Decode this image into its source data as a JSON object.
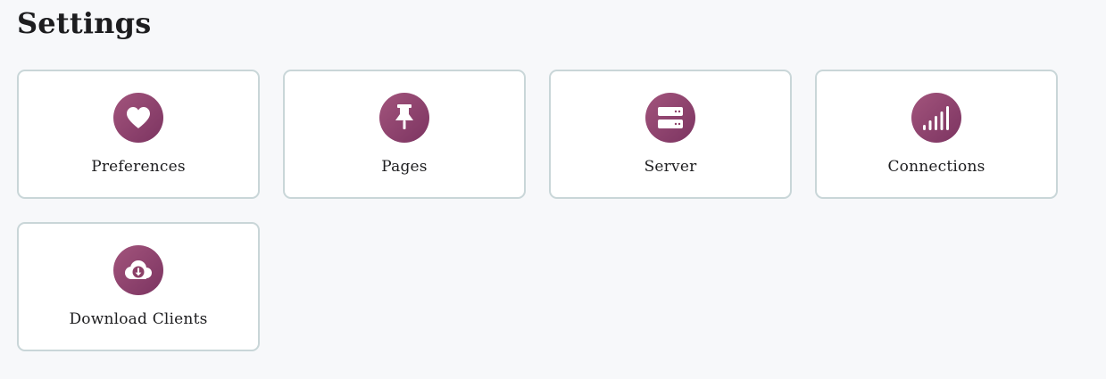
{
  "page": {
    "title": "Settings"
  },
  "accent_color": "#8c4068",
  "cards": [
    {
      "label": "Preferences",
      "icon": "heart-icon"
    },
    {
      "label": "Pages",
      "icon": "pushpin-icon"
    },
    {
      "label": "Server",
      "icon": "server-icon"
    },
    {
      "label": "Connections",
      "icon": "signal-bars-icon"
    },
    {
      "label": "Download Clients",
      "icon": "cloud-download-icon"
    }
  ]
}
